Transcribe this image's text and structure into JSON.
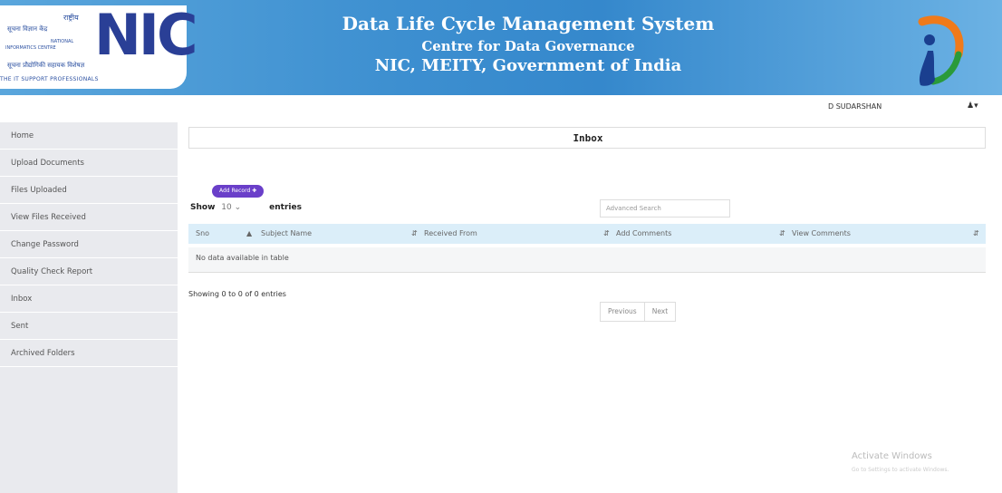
{
  "header": {
    "logo": {
      "hindi_line1": "राष्ट्रीय",
      "hindi_line2": "सूचना विज्ञान केंद्र",
      "small_line1": "NATIONAL",
      "small_line2": "INFORMATICS CENTRE",
      "hindi_line3": "सूचना प्रौद्योगिकी सहायक विशेषज्ञ",
      "tagline": "THE IT SUPPORT PROFESSIONALS",
      "wordmark": "NIC"
    },
    "title_line1": "Data Life Cycle Management System",
    "title_line2": "Centre for Data Governance",
    "title_line3": "NIC, MEITY, Government of India"
  },
  "user": {
    "name": "D SUDARSHAN",
    "menu_icon": "user-dropdown-icon"
  },
  "sidebar": {
    "items": [
      {
        "label": "Home"
      },
      {
        "label": "Upload Documents"
      },
      {
        "label": "Files Uploaded"
      },
      {
        "label": "View Files Received"
      },
      {
        "label": "Change Password"
      },
      {
        "label": "Quality Check Report"
      },
      {
        "label": "Inbox"
      },
      {
        "label": "Sent"
      },
      {
        "label": "Archived Folders"
      }
    ]
  },
  "main": {
    "page_title": "Inbox",
    "add_record_label": "Add Record ✚",
    "show_label": "Show",
    "entries_value": "10",
    "entries_label": "entries",
    "search_placeholder": "Advanced Search",
    "table": {
      "columns": [
        "Sno",
        "Subject Name",
        "Received From",
        "Add Comments",
        "View Comments"
      ],
      "empty_message": "No data available in table"
    },
    "info_text": "Showing 0 to 0 of 0 entries",
    "pagination": {
      "previous": "Previous",
      "next": "Next"
    }
  },
  "watermark": {
    "line1": "Activate Windows",
    "line2": "Go to Settings to activate Windows."
  }
}
